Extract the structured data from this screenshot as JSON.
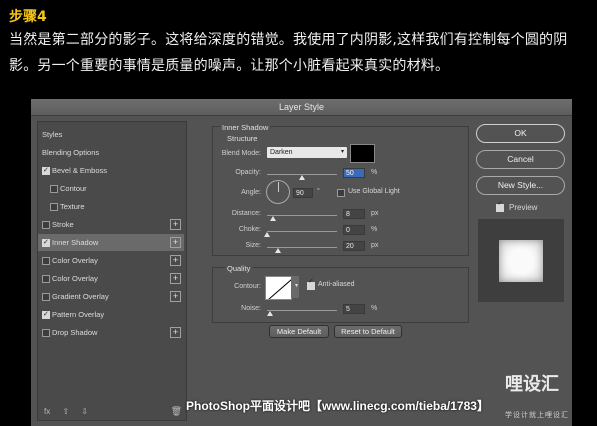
{
  "step_title": "步骤4",
  "intro_text": "当然是第二部分的影子。这将给深度的错觉。我使用了内阴影,这样我们有控制每个圆的阴影。另一个重要的事情是质量的噪声。让那个小脏看起来真实的材料。",
  "dialog": {
    "title": "Layer Style",
    "styles_list": [
      {
        "label": "Styles",
        "checkbox": false,
        "checked": false,
        "plus": false,
        "selected": false,
        "indent": false
      },
      {
        "label": "Blending Options",
        "checkbox": false,
        "checked": false,
        "plus": false,
        "selected": false,
        "indent": false
      },
      {
        "label": "Bevel & Emboss",
        "checkbox": true,
        "checked": true,
        "plus": false,
        "selected": false,
        "indent": false
      },
      {
        "label": "Contour",
        "checkbox": true,
        "checked": false,
        "plus": false,
        "selected": false,
        "indent": true
      },
      {
        "label": "Texture",
        "checkbox": true,
        "checked": false,
        "plus": false,
        "selected": false,
        "indent": true
      },
      {
        "label": "Stroke",
        "checkbox": true,
        "checked": false,
        "plus": true,
        "selected": false,
        "indent": false
      },
      {
        "label": "Inner Shadow",
        "checkbox": true,
        "checked": true,
        "plus": true,
        "selected": true,
        "indent": false
      },
      {
        "label": "Color Overlay",
        "checkbox": true,
        "checked": false,
        "plus": true,
        "selected": false,
        "indent": false
      },
      {
        "label": "Color Overlay",
        "checkbox": true,
        "checked": false,
        "plus": true,
        "selected": false,
        "indent": false
      },
      {
        "label": "Gradient Overlay",
        "checkbox": true,
        "checked": false,
        "plus": true,
        "selected": false,
        "indent": false
      },
      {
        "label": "Pattern Overlay",
        "checkbox": true,
        "checked": true,
        "plus": false,
        "selected": false,
        "indent": false
      },
      {
        "label": "Drop Shadow",
        "checkbox": true,
        "checked": false,
        "plus": true,
        "selected": false,
        "indent": false
      }
    ],
    "bottom_icons": {
      "fx": "fx",
      "up": "⇧",
      "down": "⇩",
      "trash": "🗑"
    },
    "inner_shadow": {
      "section_title": "Inner Shadow",
      "subsection": "Structure",
      "blend_mode_label": "Blend Mode:",
      "blend_mode_value": "Darken",
      "shadow_color": "#000000",
      "opacity_label": "Opacity:",
      "opacity_value": "50",
      "opacity_unit": "%",
      "opacity_fraction": 0.5,
      "angle_label": "Angle:",
      "angle_value": "90",
      "angle_unit": "°",
      "use_global_light_label": "Use Global Light",
      "use_global_light": false,
      "distance_label": "Distance:",
      "distance_value": "8",
      "distance_unit": "px",
      "choke_label": "Choke:",
      "choke_value": "0",
      "choke_unit": "%",
      "size_label": "Size:",
      "size_value": "20",
      "size_unit": "px"
    },
    "quality": {
      "section_title": "Quality",
      "contour_label": "Contour:",
      "anti_aliased_label": "Anti-aliased",
      "anti_aliased": true,
      "noise_label": "Noise:",
      "noise_value": "5",
      "noise_unit": "%"
    },
    "make_default": "Make Default",
    "reset_to_default": "Reset to Default",
    "ok": "OK",
    "cancel": "Cancel",
    "new_style": "New Style...",
    "preview_label": "Preview",
    "preview_checked": true
  },
  "footer_text": "PhotoShop平面设计吧【www.linecg.com/tieba/1783】",
  "logo_text": "哩设汇",
  "logo_subtext": "学设计就上哩设汇"
}
